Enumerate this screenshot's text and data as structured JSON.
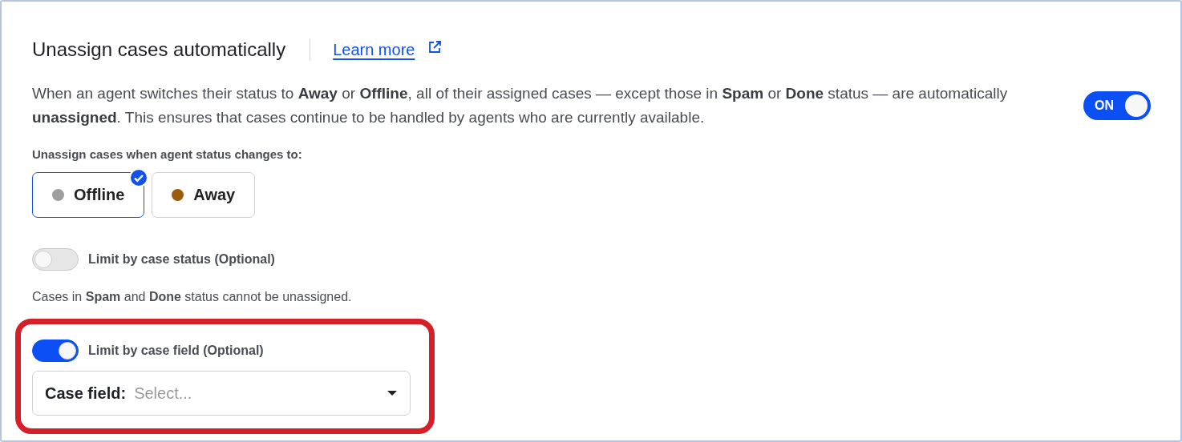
{
  "header": {
    "title": "Unassign cases automatically",
    "link": "Learn more"
  },
  "description": "When an agent switches their status to **Away** or **Offline**, all of their assigned cases — except those in **Spam** or **Done** status — are automatically **unassigned**. This ensures that cases continue to be handled by agents who are currently available.",
  "master_toggle": {
    "label": "ON",
    "on": true
  },
  "status_group": {
    "label": "Unassign cases when agent status changes to:",
    "options": [
      {
        "label": "Offline",
        "color": "#9e9e9e",
        "selected": true
      },
      {
        "label": "Away",
        "color": "#9a5d0f",
        "selected": false
      }
    ]
  },
  "status_filter": {
    "label": "Limit by case status (Optional)",
    "on": false,
    "note": "Cases in **Spam** and **Done** status cannot be unassigned."
  },
  "field_filter": {
    "label": "Limit by case field (Optional)",
    "on": true,
    "highlighted": true,
    "select": {
      "label": "Case field:",
      "placeholder": "Select..."
    }
  }
}
